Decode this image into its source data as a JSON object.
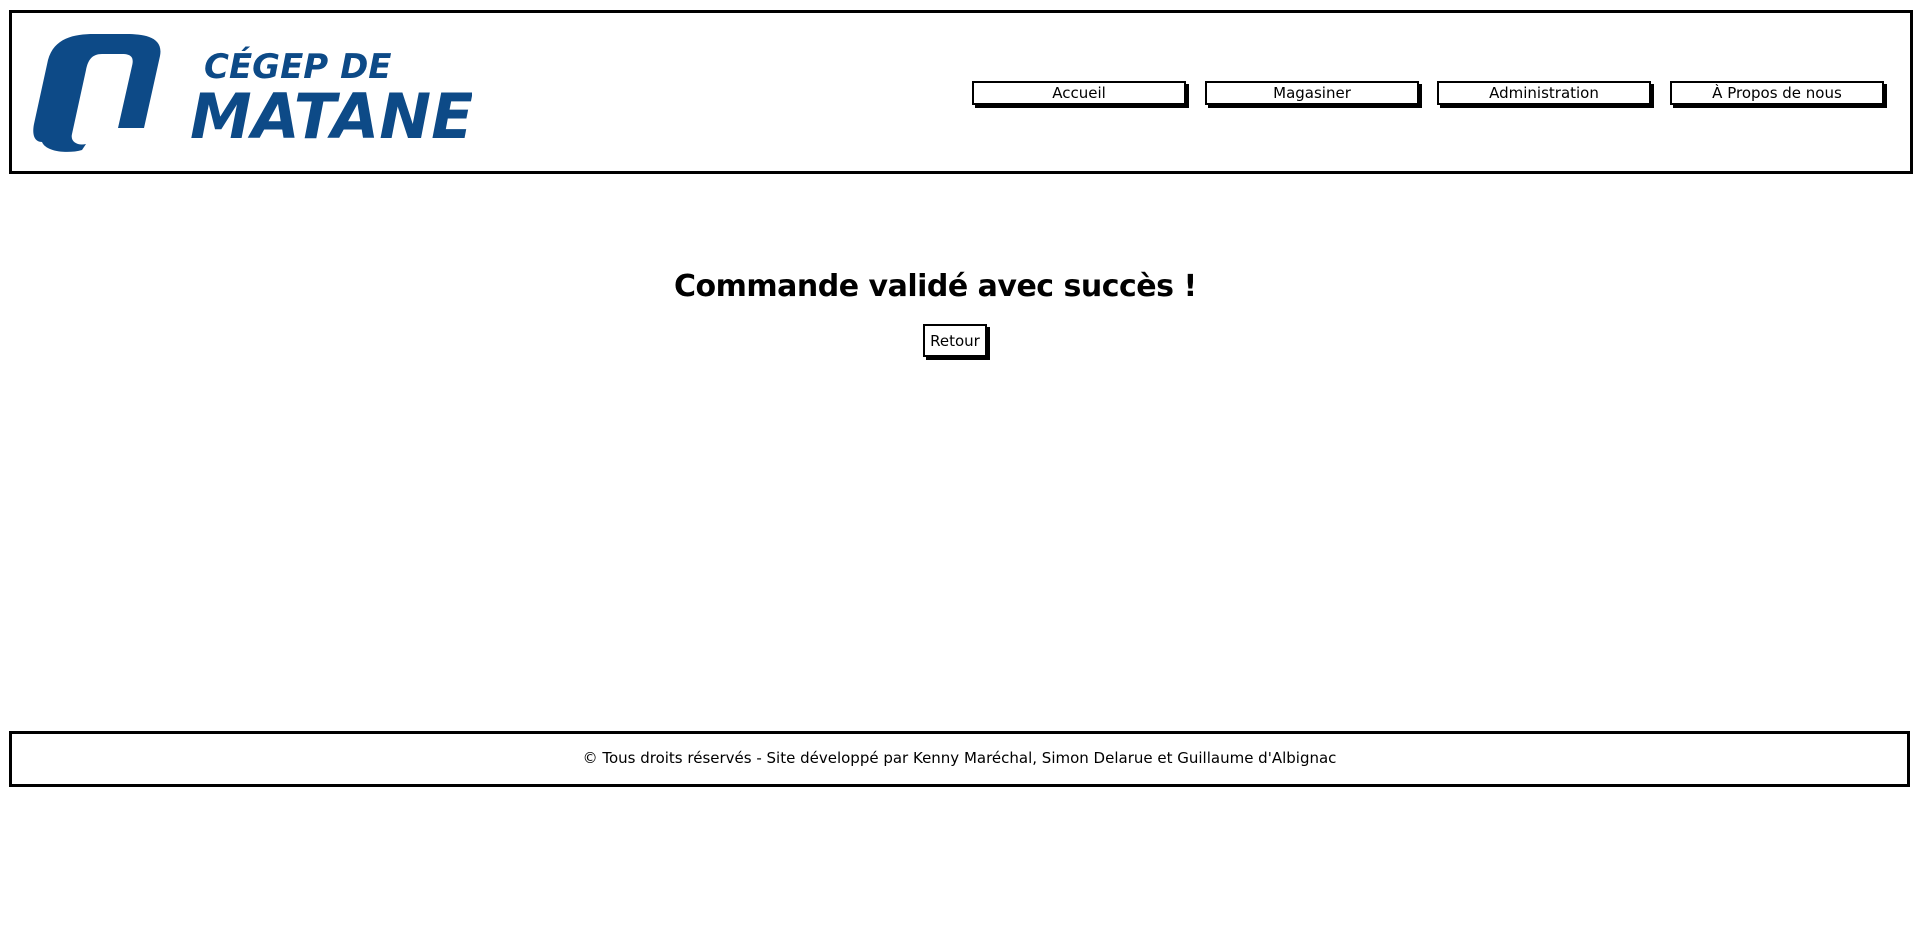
{
  "brand": {
    "line1": "CÉGEP DE",
    "line2": "MATANE",
    "color": "#0d4a87"
  },
  "nav": {
    "items": [
      {
        "label": "Accueil"
      },
      {
        "label": "Magasiner"
      },
      {
        "label": "Administration"
      },
      {
        "label": "À Propos de nous"
      }
    ]
  },
  "main": {
    "title": "Commande validé avec succès !",
    "back_label": "Retour"
  },
  "footer": {
    "text": "© Tous droits réservés - Site développé par Kenny Maréchal, Simon Delarue et Guillaume d'Albignac"
  }
}
